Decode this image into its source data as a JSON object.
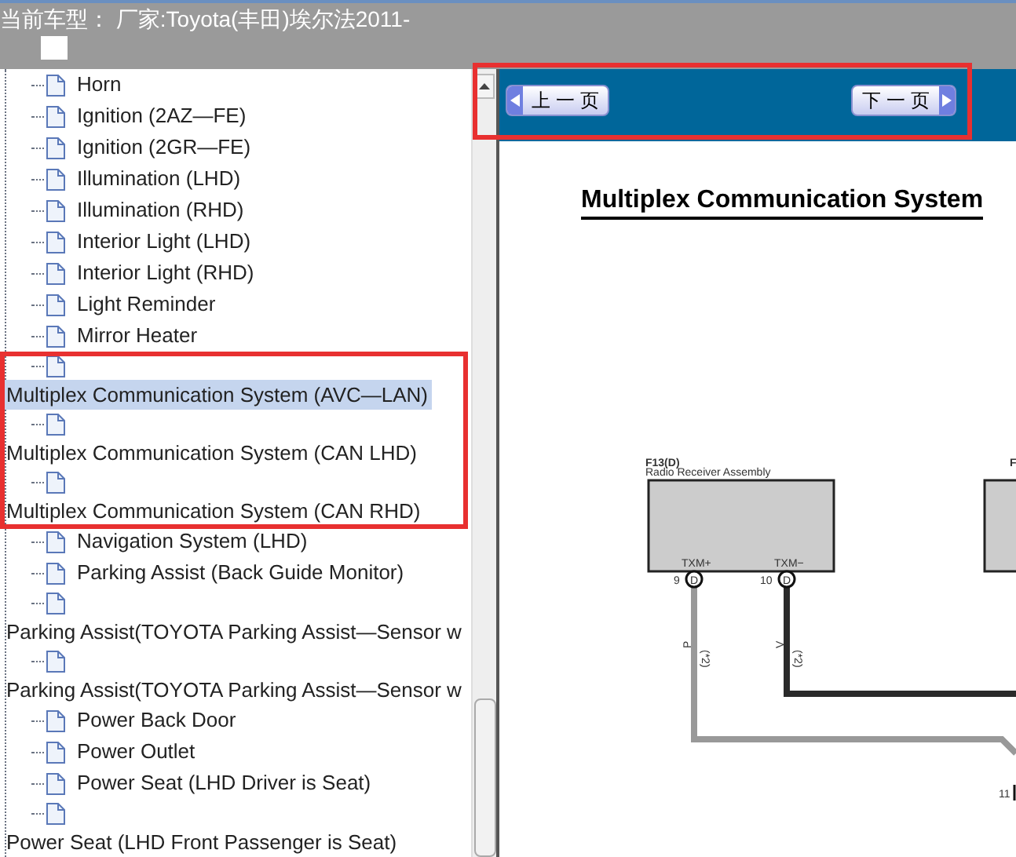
{
  "header": {
    "title": "当前车型： 厂家:Toyota(丰田)埃尔法2011-"
  },
  "tree": {
    "items": [
      {
        "label": "Horn",
        "kind": "leaf",
        "selected": false
      },
      {
        "label": "Ignition (2AZ—FE)",
        "kind": "leaf",
        "selected": false
      },
      {
        "label": "Ignition (2GR—FE)",
        "kind": "leaf",
        "selected": false
      },
      {
        "label": "Illumination (LHD)",
        "kind": "leaf",
        "selected": false
      },
      {
        "label": "Illumination (RHD)",
        "kind": "leaf",
        "selected": false
      },
      {
        "label": "Interior Light (LHD)",
        "kind": "leaf",
        "selected": false
      },
      {
        "label": "Interior Light (RHD)",
        "kind": "leaf",
        "selected": false
      },
      {
        "label": "Light Reminder",
        "kind": "leaf",
        "selected": false
      },
      {
        "label": "Mirror Heater",
        "kind": "leaf",
        "selected": false
      },
      {
        "label": "Multiplex Communication System (AVC—LAN)",
        "kind": "wrapped",
        "selected": true
      },
      {
        "label": "Multiplex Communication System (CAN LHD)",
        "kind": "wrapped",
        "selected": false
      },
      {
        "label": "Multiplex Communication System (CAN RHD)",
        "kind": "wrapped",
        "selected": false
      },
      {
        "label": "Navigation System (LHD)",
        "kind": "leaf",
        "selected": false
      },
      {
        "label": "Parking Assist (Back Guide Monitor)",
        "kind": "leaf",
        "selected": false
      },
      {
        "label": "Parking Assist(TOYOTA Parking Assist—Sensor w",
        "kind": "wrapped",
        "selected": false
      },
      {
        "label": "Parking Assist(TOYOTA Parking Assist—Sensor w",
        "kind": "wrapped",
        "selected": false
      },
      {
        "label": "Power Back Door",
        "kind": "leaf",
        "selected": false
      },
      {
        "label": "Power Outlet",
        "kind": "leaf",
        "selected": false
      },
      {
        "label": "Power Seat (LHD Driver is Seat)",
        "kind": "leaf",
        "selected": false
      },
      {
        "label": "Power Seat (LHD Front Passenger is Seat)",
        "kind": "wrapped",
        "selected": false
      }
    ]
  },
  "document": {
    "nav_buttons": [
      {
        "label": "上 一 页",
        "kind": "prev"
      },
      {
        "label": "下 一 页",
        "kind": "next"
      }
    ],
    "title": "Multiplex Communication System",
    "diagram": {
      "connector": "F13(D)",
      "component": "Radio Receiver Assembly",
      "pins": [
        {
          "signal": "TXM+",
          "number": "9",
          "terminal": "D",
          "wire": "P",
          "note": "(*2)"
        },
        {
          "signal": "TXM−",
          "number": "10",
          "terminal": "D",
          "wire": "V",
          "note": "(*2)"
        }
      ],
      "next_connector": "F",
      "lower_pin": "11"
    }
  }
}
